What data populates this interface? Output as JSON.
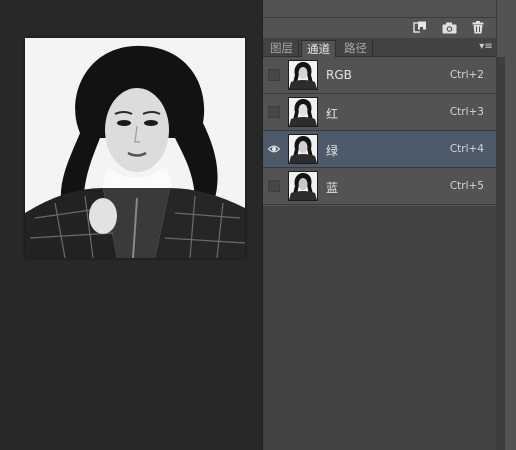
{
  "toolbar": {
    "icons": [
      "new-channel-icon",
      "camera-icon",
      "trash-icon"
    ]
  },
  "tabs": [
    {
      "label": "图层",
      "active": false
    },
    {
      "label": "通道",
      "active": true
    },
    {
      "label": "路径",
      "active": false
    }
  ],
  "channels": [
    {
      "name": "RGB",
      "shortcut": "Ctrl+2",
      "visible": false,
      "selected": false
    },
    {
      "name": "红",
      "shortcut": "Ctrl+3",
      "visible": false,
      "selected": false
    },
    {
      "name": "绿",
      "shortcut": "Ctrl+4",
      "visible": true,
      "selected": true
    },
    {
      "name": "蓝",
      "shortcut": "Ctrl+5",
      "visible": false,
      "selected": false
    }
  ],
  "colors": {
    "selected_row": "#4d5a6a",
    "panel_bg": "#535353",
    "canvas_bg": "#282828"
  }
}
